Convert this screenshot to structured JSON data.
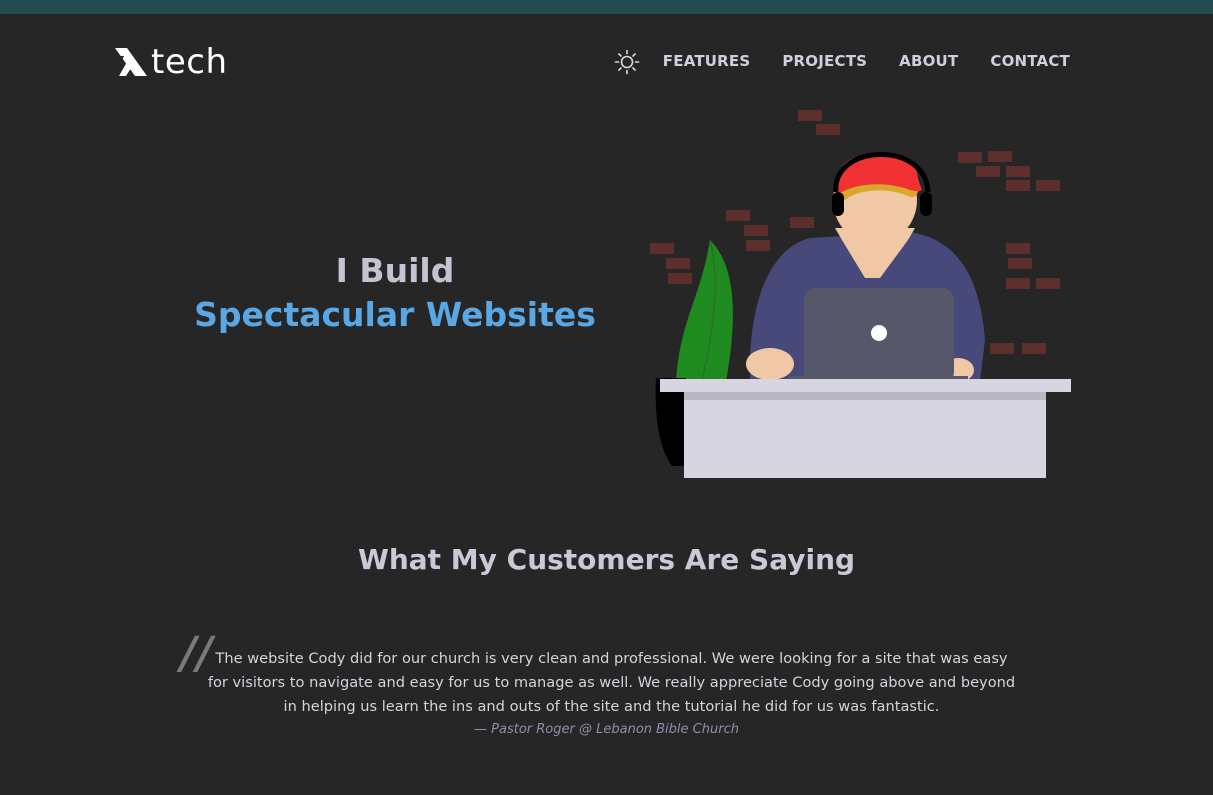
{
  "header": {
    "logo_text": "tech",
    "theme_toggle_icon": "sun-icon",
    "nav": [
      {
        "label": "FEATURES"
      },
      {
        "label": "PROJECTS"
      },
      {
        "label": "ABOUT"
      },
      {
        "label": "CONTACT"
      }
    ]
  },
  "hero": {
    "line1": "I Build",
    "line2": "Spectacular Websites"
  },
  "testimonials": {
    "title": "What My Customers Are Saying",
    "quote": "The website Cody did for our church is very clean and professional. We were looking for a site that was easy for visitors to navigate and easy for us to manage as well. We really appreciate Cody going above and beyond in helping us learn the ins and outs of the site and the tutorial he did for us was fantastic.",
    "author": "— Pastor Roger @ Lebanon Bible Church"
  },
  "colors": {
    "background": "#262626",
    "top_bar": "#244b4d",
    "accent": "#5aa7e4",
    "text": "#c3c3d1"
  }
}
